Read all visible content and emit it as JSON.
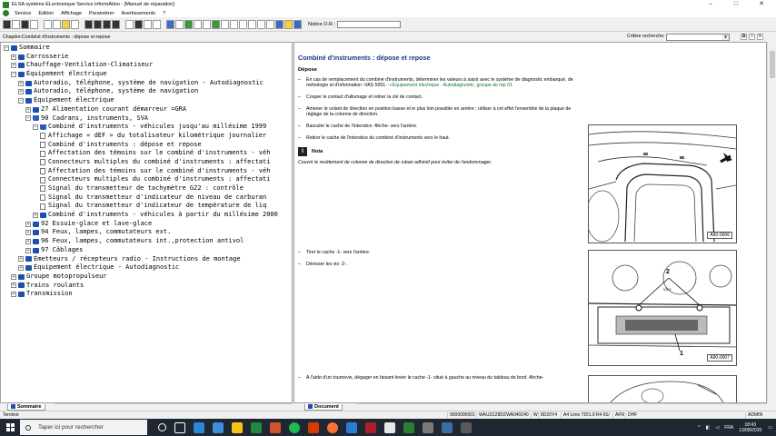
{
  "window": {
    "title": "ELSA système ELectronique Service informAtion - [Manuel de réparation]",
    "controls": [
      "–",
      "□",
      "✕"
    ]
  },
  "menu": {
    "items": [
      "Service",
      "Edition",
      "Affichage",
      "Paramètrer",
      "Avertissements",
      "?"
    ]
  },
  "toolbar": {
    "notice_label": "Notice O.R.:",
    "notice_value": ""
  },
  "chapter": {
    "text": "Chapitre:Combiné d'instruments : dépose et repose",
    "criteria_label": "Critère recherche:",
    "criteria_value": ""
  },
  "tree": [
    {
      "level": 0,
      "exp": "−",
      "type": "book",
      "label": "Sommaire"
    },
    {
      "level": 1,
      "exp": "+",
      "type": "book",
      "label": "Carrosserie"
    },
    {
      "level": 1,
      "exp": "+",
      "type": "book",
      "label": "Chauffage-Ventilation-Climatiseur"
    },
    {
      "level": 1,
      "exp": "−",
      "type": "book",
      "label": "Équipement électrique"
    },
    {
      "level": 2,
      "exp": "+",
      "type": "book",
      "label": "Autoradio, téléphone, système de navigation - Autodiagnostic"
    },
    {
      "level": 2,
      "exp": "+",
      "type": "book",
      "label": "Autoradio, téléphone, système de navigation"
    },
    {
      "level": 2,
      "exp": "−",
      "type": "book",
      "label": "Équipement électrique"
    },
    {
      "level": 3,
      "exp": "+",
      "type": "book",
      "label": "27 Alimentation courant démarreur =GRA"
    },
    {
      "level": 3,
      "exp": "−",
      "type": "open",
      "label": "90 Cadrans, instruments, SVA"
    },
    {
      "level": 4,
      "exp": "−",
      "type": "open",
      "label": "Combiné d'instruments - véhicules jusqu'au millésime 1999"
    },
    {
      "level": 5,
      "exp": "",
      "type": "doc",
      "label": "Affichage « dEF » du totalisateur kilométrique journalier"
    },
    {
      "level": 5,
      "exp": "",
      "type": "doc",
      "label": "Combiné d'instruments : dépose et repose"
    },
    {
      "level": 5,
      "exp": "",
      "type": "doc",
      "label": "Affectation des témoins sur le combiné d'instruments - véh"
    },
    {
      "level": 5,
      "exp": "",
      "type": "doc",
      "label": "Connecteurs multiples du combiné d'instruments : affectati"
    },
    {
      "level": 5,
      "exp": "",
      "type": "doc",
      "label": "Affectation des témoins sur le combiné d'instruments - véh"
    },
    {
      "level": 5,
      "exp": "",
      "type": "doc",
      "label": "Connecteurs multiples du combiné d'instruments : affectati"
    },
    {
      "level": 5,
      "exp": "",
      "type": "doc",
      "label": "Signal du  transmetteur de tachymètre G22  : contrôle"
    },
    {
      "level": 5,
      "exp": "",
      "type": "doc",
      "label": "Signal du  transmetteur d'indicateur de niveau de carburan"
    },
    {
      "level": 5,
      "exp": "",
      "type": "doc",
      "label": "Signal du  transmetteur d'indicateur de température de liq"
    },
    {
      "level": 4,
      "exp": "+",
      "type": "book",
      "label": "Combiné d'instruments - véhicules à partir du millésime 2000"
    },
    {
      "level": 3,
      "exp": "+",
      "type": "book",
      "label": "92 Essuie-glace et lave-glace"
    },
    {
      "level": 3,
      "exp": "+",
      "type": "book",
      "label": "94 Feux, lampes, commutateurs ext."
    },
    {
      "level": 3,
      "exp": "+",
      "type": "book",
      "label": "96 Feux, lampes, commutateurs int.,protection antivol"
    },
    {
      "level": 3,
      "exp": "+",
      "type": "book",
      "label": "97 Câblages"
    },
    {
      "level": 2,
      "exp": "+",
      "type": "book",
      "label": "Émetteurs / récepteurs radio - Instructions de montage"
    },
    {
      "level": 2,
      "exp": "+",
      "type": "book",
      "label": "Équipement électrique - Autodiagnostic"
    },
    {
      "level": 1,
      "exp": "+",
      "type": "book",
      "label": "Groupe motopropulseur"
    },
    {
      "level": 1,
      "exp": "+",
      "type": "book",
      "label": "Trains roulants"
    },
    {
      "level": 1,
      "exp": "+",
      "type": "book",
      "label": "Transmission"
    }
  ],
  "document": {
    "title": "Combiné d'instruments : dépose et repose",
    "section": "Dépose",
    "p1_a": "En cas de remplacement du combiné d'instruments, déterminer les valeurs à saisir avec le système de diagnostic embarqué, de métrologie et d'information -VAS 5051- ",
    "p1_link": "⇒Équipement électrique - Autodiagnostic, groupe de rép 01",
    "p2": "Couper le contact d'allumage et retirer la clé de contact.",
    "p3": "Amener le volant de direction en position basse et le plus loin possible en arrière ; utiliser à cet effet l'ensemble de la plaque de réglage de la colonne de direction.",
    "p4": "Basculer le cache de l'interstice -flèche- vers l'arrière.",
    "p5": "Retirer le cache de l'interstice du combiné d'instruments vers le haut.",
    "nota_label": "Nota",
    "nota_text": "Couvrir le revêtement de colonne de direction de ruban adhésif pour éviter de l'endommager.",
    "p6": "Tirer le cache -1- vers l'arrière.",
    "p7": "Dévisser les vis -2-.",
    "p8": "À l'aide d'un tournevis, dégager en faisant levier le cache -1- situé à gauche au niveau du tableau de bord -flèche-",
    "fig1_label": "A90-0006",
    "fig2_label": "A90-0007",
    "fig2_num1": "1",
    "fig2_num2": "2",
    "fig2_vdo": "VDO"
  },
  "tabs": {
    "left": "Sommaire",
    "right": "Document"
  },
  "status": {
    "left": "Terminé",
    "cells": [
      "9000000001",
      "WAUZZZ8DZWA040240",
      "W",
      "8D20Y4",
      "A4 Limo TDI1.9 R4 81/",
      "AFN",
      "DHF",
      "ADMIN"
    ]
  },
  "taskbar": {
    "search_placeholder": "Taper ici pour rechercher",
    "lang": "FRA",
    "time": "18:43",
    "date": "13/08/2020"
  },
  "colors": {
    "doc_title": "#1a3a8a",
    "link": "#0a7a2a",
    "taskbar": "#1f2733"
  }
}
